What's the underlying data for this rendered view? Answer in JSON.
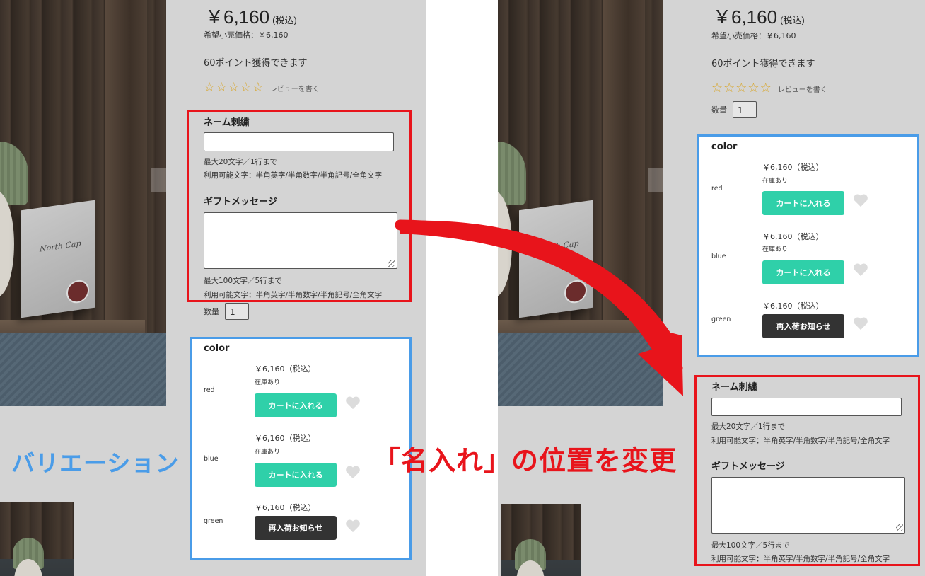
{
  "product": {
    "price": "￥6,160",
    "price_tax": "(税込)",
    "msrp": "希望小売価格：￥6,160",
    "points": "60ポイント獲得できます",
    "review_link": "レビューを書く",
    "quantity_label": "数量",
    "quantity_value": "1",
    "star_glyph": "☆"
  },
  "personalization": {
    "name_title": "ネーム刺繍",
    "name_value": "",
    "name_note1": "最大20文字／1行まで",
    "name_note2": "利用可能文字：半角英字/半角数字/半角記号/全角文字",
    "gift_title": "ギフトメッセージ",
    "gift_value": "",
    "gift_note1": "最大100文字／5行まで",
    "gift_note2": "利用可能文字：半角英字/半角数字/半角記号/全角文字"
  },
  "variations": {
    "title": "color",
    "items": [
      {
        "name": "red",
        "price": "￥6,160（税込）",
        "stock": "在庫あり",
        "button": "カートに入れる",
        "button_type": "cart"
      },
      {
        "name": "blue",
        "price": "￥6,160（税込）",
        "stock": "在庫あり",
        "button": "カートに入れる",
        "button_type": "cart"
      },
      {
        "name": "green",
        "price": "￥6,160（税込）",
        "stock": "",
        "button": "再入荷お知らせ",
        "button_type": "notify"
      }
    ]
  },
  "annotations": {
    "variation_label": "バリエーション",
    "change_label": "「名入れ」の位置を変更"
  },
  "colors": {
    "cart_button": "#2fd0a9",
    "notify_button": "#333333",
    "frame_red": "#e8141b",
    "frame_blue": "#4a9ce8",
    "star": "#d8a62a"
  },
  "icons": [
    "star-icon",
    "heart-icon",
    "resize-grip-icon",
    "curved-arrow-icon"
  ]
}
